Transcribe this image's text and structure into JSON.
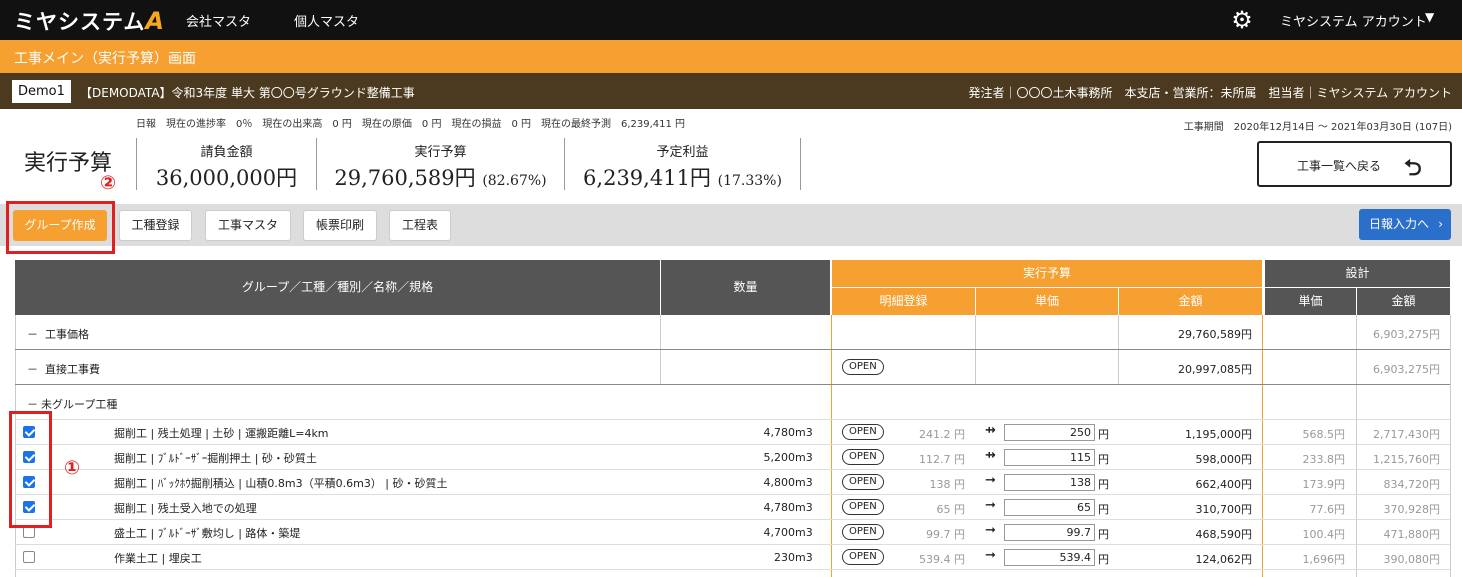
{
  "header": {
    "logo_text": "ミヤシステム",
    "logo_accent": "A",
    "nav": [
      "会社マスタ",
      "個人マスタ"
    ],
    "account": "ミヤシステム アカウント",
    "account_arrow": "▼"
  },
  "screen_title": "工事メイン（実行予算）画面",
  "project": {
    "tag": "Demo1",
    "name": "【DEMODATA】令和3年度 単大 第〇〇号グラウンド整備工事",
    "orderer": "発注者｜〇〇〇土木事務所　本支店・営業所：未所属　担当者｜ミヤシステム アカウント"
  },
  "info_line": "日報　現在の進捗率　0％　現在の出来高　0 円　現在の原価　0 円　現在の損益　0 円　現在の最終予測　6,239,411 円",
  "period": "工事期間　2020年12月14日 〜 2021年03月30日 (107日)",
  "page_title": "実行予算",
  "annotations": {
    "one": "①",
    "two": "②"
  },
  "summary": [
    {
      "label": "請負金額",
      "value": "36,000,000円",
      "pct": ""
    },
    {
      "label": "実行予算",
      "value": "29,760,589円",
      "pct": "(82.67%)"
    },
    {
      "label": "予定利益",
      "value": "6,239,411円",
      "pct": "(17.33%)"
    }
  ],
  "back_button": {
    "label": "工事一覧へ戻る",
    "icon": "⮌"
  },
  "toolbar": {
    "buttons": [
      "グループ作成",
      "工種登録",
      "工事マスタ",
      "帳票印刷",
      "工程表"
    ],
    "daily_button": "日報入力へ",
    "daily_arrow": "›"
  },
  "table": {
    "headers": {
      "name": "グループ／工種／種別／名称／規格",
      "qty": "数量",
      "exec_budget": "実行予算",
      "detail": "明細登録",
      "unit_price": "単価",
      "amount": "金額",
      "design": "設計",
      "design_unit": "単価",
      "design_amount": "金額"
    },
    "groups": [
      {
        "toggle": "－",
        "name": "工事価格",
        "amount": "29,760,589円",
        "design_amount": "6,903,275円",
        "open": ""
      },
      {
        "toggle": "－",
        "name": "直接工事費",
        "amount": "20,997,085円",
        "design_amount": "6,903,275円",
        "open": "OPEN"
      },
      {
        "toggle": "－",
        "name": "未グループ工種",
        "amount": "",
        "design_amount": "",
        "open": ""
      }
    ],
    "open_label": "OPEN",
    "yen": "円",
    "rows": [
      {
        "checked": true,
        "name": "掘削工 | 残土処理 | 土砂 | 運搬距離L=4km",
        "qty": "4,780",
        "unit": "m3",
        "ref": "241.2 円",
        "arrow": "⇸",
        "price": "250",
        "amount": "1,195,000円",
        "d_unit": "568.5円",
        "d_amount": "2,717,430円"
      },
      {
        "checked": true,
        "name": "掘削工 | ﾌﾞﾙﾄﾞｰｻﾞｰ掘削押土 | 砂・砂質土",
        "qty": "5,200",
        "unit": "m3",
        "ref": "112.7 円",
        "arrow": "⇸",
        "price": "115",
        "amount": "598,000円",
        "d_unit": "233.8円",
        "d_amount": "1,215,760円"
      },
      {
        "checked": true,
        "name": "掘削工 | ﾊﾞｯｸﾎｳ掘削積込 | 山積0.8m3（平積0.6m3） | 砂・砂質土",
        "qty": "4,800",
        "unit": "m3",
        "ref": "138 円",
        "arrow": "➞",
        "price": "138",
        "amount": "662,400円",
        "d_unit": "173.9円",
        "d_amount": "834,720円"
      },
      {
        "checked": true,
        "name": "掘削工 | 残土受入地での処理",
        "qty": "4,780",
        "unit": "m3",
        "ref": "65 円",
        "arrow": "➞",
        "price": "65",
        "amount": "310,700円",
        "d_unit": "77.6円",
        "d_amount": "370,928円"
      },
      {
        "checked": false,
        "name": "盛土工 | ﾌﾞﾙﾄﾞｰｻﾞ敷均し | 路体・築堤",
        "qty": "4,700",
        "unit": "m3",
        "ref": "99.7 円",
        "arrow": "➞",
        "price": "99.7",
        "amount": "468,590円",
        "d_unit": "100.4円",
        "d_amount": "471,880円"
      },
      {
        "checked": false,
        "name": "作業土工 | 埋戻工",
        "qty": "230",
        "unit": "m3",
        "ref": "539.4 円",
        "arrow": "➞",
        "price": "539.4",
        "amount": "124,062円",
        "d_unit": "1,696円",
        "d_amount": "390,080円"
      }
    ]
  }
}
